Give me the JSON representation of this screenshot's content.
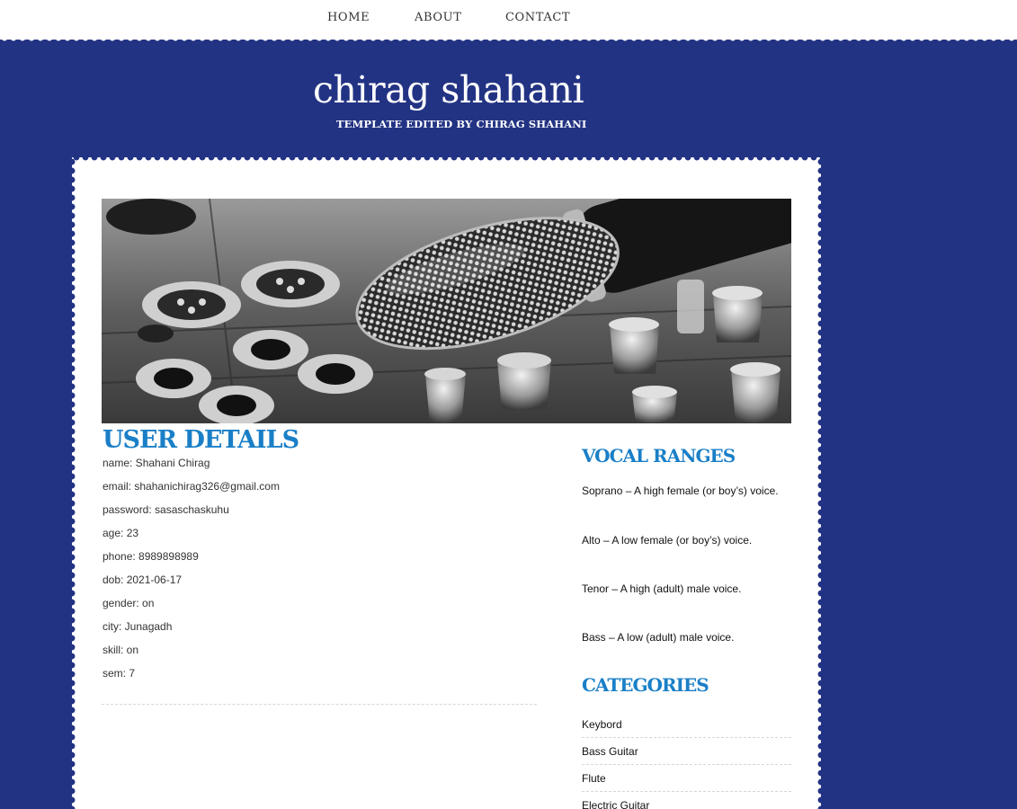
{
  "nav": {
    "items": [
      "HOME",
      "ABOUT",
      "CONTACT"
    ]
  },
  "header": {
    "title": "chirag shahani",
    "subtitle": "TEMPLATE EDITED BY CHIRAG SHAHANI"
  },
  "main": {
    "title": "USER DETAILS",
    "details": [
      "name: Shahani Chirag",
      "email: shahanichirag326@gmail.com",
      "password: sasaschaskuhu",
      "age: 23",
      "phone: 8989898989",
      "dob: 2021-06-17",
      "gender: on",
      "city: Junagadh",
      "skill: on",
      "sem: 7"
    ]
  },
  "sidebar": {
    "vocal_title": "VOCAL RANGES",
    "vocal_ranges": [
      "Soprano – A high female (or boy’s) voice.",
      "Alto – A low female (or boy’s) voice.",
      "Tenor – A high (adult) male voice.",
      "Bass – A low (adult) male voice."
    ],
    "categories_title": "CATEGORIES",
    "categories": [
      "Keybord",
      "Bass Guitar",
      "Flute",
      "Electric Guitar"
    ]
  },
  "colors": {
    "background": "#233384",
    "accent": "#1a7fc7",
    "card": "#ffffff"
  }
}
